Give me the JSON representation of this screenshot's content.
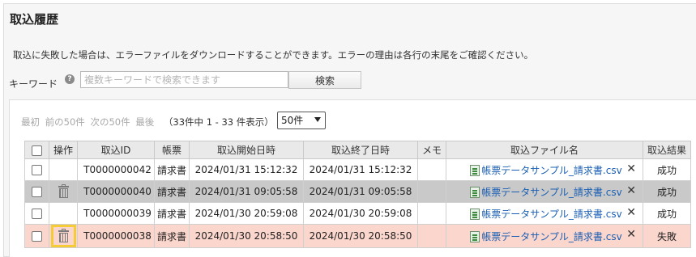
{
  "page": {
    "title": "取込履歴",
    "description": "取込に失敗した場合は、エラーファイルをダウンロードすることができます。エラーの理由は各行の末尾をご確認ください。"
  },
  "search": {
    "label": "キーワード",
    "placeholder": "複数キーワードで検索できます",
    "button_label": "検索"
  },
  "pager": {
    "first": "最初",
    "prev": "前の50件",
    "next": "次の50件",
    "last": "最後",
    "count": "（33件中 1 - 33 件表示）",
    "per_page": "50件"
  },
  "table": {
    "headers": [
      "",
      "操作",
      "取込ID",
      "帳票",
      "取込開始日時",
      "取込終了日時",
      "メモ",
      "取込ファイル名",
      "取込結果"
    ],
    "rows": [
      {
        "id": "T0000000042",
        "form": "請求書",
        "start": "2024/01/31 15:12:32",
        "end": "2024/01/31 15:12:32",
        "memo": "",
        "file": "帳票データサンプル_請求書.csv",
        "result": "成功",
        "style": "normal",
        "has_trash": false
      },
      {
        "id": "T0000000040",
        "form": "請求書",
        "start": "2024/01/31 09:05:58",
        "end": "2024/01/31 09:05:58",
        "memo": "",
        "file": "帳票データサンプル_請求書.csv",
        "result": "成功",
        "style": "gray",
        "has_trash": true
      },
      {
        "id": "T0000000039",
        "form": "請求書",
        "start": "2024/01/30 20:59:08",
        "end": "2024/01/30 20:59:08",
        "memo": "",
        "file": "帳票データサンプル_請求書.csv",
        "result": "成功",
        "style": "normal",
        "has_trash": false
      },
      {
        "id": "T0000000038",
        "form": "請求書",
        "start": "2024/01/30 20:58:50",
        "end": "2024/01/30 20:58:50",
        "memo": "",
        "file": "帳票データサンプル_請求書.csv",
        "result": "失敗",
        "style": "red",
        "has_trash": true,
        "highlight": true
      }
    ]
  },
  "icons": {
    "help": "question-circle-icon",
    "trash": "trash-icon",
    "file": "csv-file-icon",
    "delete": "close-icon"
  },
  "colors": {
    "link": "#1a5fb4",
    "error": "#d81b1b",
    "error_row": "#fbd6cc",
    "selected_row": "#c9c9c9",
    "highlight": "#f5cc36"
  }
}
